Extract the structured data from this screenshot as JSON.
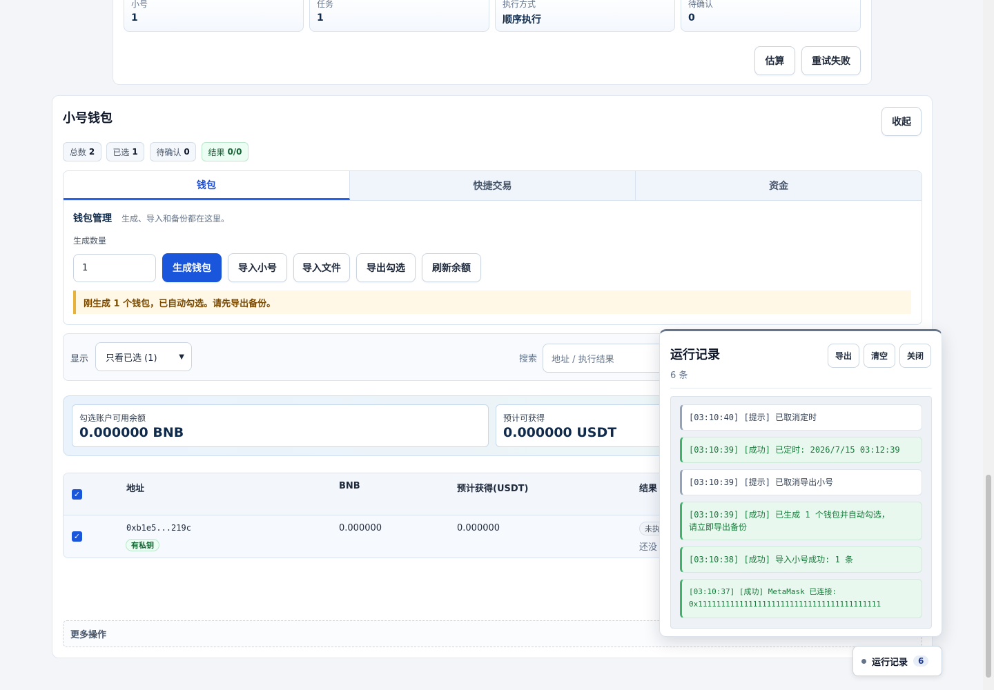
{
  "top_stats": [
    {
      "label": "小号",
      "value": "1"
    },
    {
      "label": "任务",
      "value": "1"
    },
    {
      "label": "执行方式",
      "value": "顺序执行"
    },
    {
      "label": "待确认",
      "value": "0"
    }
  ],
  "top_buttons": {
    "estimate": "估算",
    "retry_failed": "重试失败"
  },
  "wallet": {
    "title": "小号钱包",
    "collapse": "收起",
    "chips": [
      {
        "label": "总数",
        "value": "2"
      },
      {
        "label": "已选",
        "value": "1"
      },
      {
        "label": "待确认",
        "value": "0"
      },
      {
        "label": "结果",
        "value": "0/0"
      }
    ],
    "tabs": [
      "钱包",
      "快捷交易",
      "资金"
    ],
    "mgmt_title": "钱包管理",
    "mgmt_desc": "生成、导入和备份都在这里。",
    "gen_count_label": "生成数量",
    "gen_count_value": "1",
    "buttons": {
      "generate": "生成钱包",
      "import_sub": "导入小号",
      "import_file": "导入文件",
      "export_selected": "导出勾选",
      "refresh_balance": "刷新余额"
    },
    "notice": "刚生成 1 个钱包，已自动勾选。请先导出备份。",
    "filter": {
      "show_label": "显示",
      "show_value": "只看已选 (1)",
      "search_label": "搜索",
      "search_placeholder": "地址 / 执行结果"
    },
    "summary": [
      {
        "label": "勾选账户可用余额",
        "value": "0.000000 BNB"
      },
      {
        "label": "预计可获得",
        "value": "0.000000 USDT"
      }
    ],
    "table": {
      "headers": [
        "地址",
        "BNB",
        "预计获得(USDT)",
        "结果"
      ],
      "rows": [
        {
          "address": "0xb1e5...219c",
          "badge": "有私钥",
          "bnb": "0.000000",
          "est": "0.000000",
          "status": "未执",
          "result": "还没"
        }
      ]
    },
    "more": "更多操作"
  },
  "log": {
    "title": "运行记录",
    "count": "6 条",
    "buttons": {
      "export": "导出",
      "clear": "清空",
      "close": "关闭"
    },
    "entries": [
      {
        "type": "info",
        "text": "[03:10:40] [提示] 已取消定时"
      },
      {
        "type": "ok",
        "text": "[03:10:39] [成功] 已定时: 2026/7/15 03:12:39"
      },
      {
        "type": "info",
        "text": "[03:10:39] [提示] 已取消导出小号"
      },
      {
        "type": "ok",
        "line1": "[03:10:39] [成功] 已生成 1 个钱包并自动勾选，",
        "line2": "请立即导出备份"
      },
      {
        "type": "ok",
        "text": "[03:10:38] [成功] 导入小号成功: 1 条"
      },
      {
        "type": "ok",
        "line1": "[03:10:37] [成功] MetaMask 已连接:",
        "line2": "0x1111111111111111111111111111111111111111"
      }
    ]
  },
  "log_pill": {
    "label": "运行记录",
    "count": "6"
  }
}
